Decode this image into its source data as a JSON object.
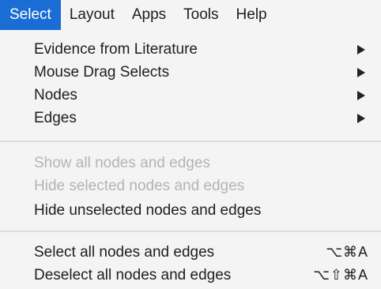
{
  "menubar": {
    "items": [
      {
        "label": "Select"
      },
      {
        "label": "Layout"
      },
      {
        "label": "Apps"
      },
      {
        "label": "Tools"
      },
      {
        "label": "Help"
      }
    ]
  },
  "menu": {
    "items": [
      {
        "label": "Evidence from Literature",
        "submenu": true
      },
      {
        "label": "Mouse Drag Selects",
        "submenu": true
      },
      {
        "label": "Nodes",
        "submenu": true
      },
      {
        "label": "Edges",
        "submenu": true
      },
      {
        "label": "Show all nodes and edges",
        "enabled": false
      },
      {
        "label": "Hide selected nodes and edges",
        "enabled": false
      },
      {
        "label": "Hide unselected nodes and edges",
        "enabled": true
      },
      {
        "label": "Select all nodes and edges",
        "shortcut": "⌥⌘A"
      },
      {
        "label": "Deselect all nodes and edges",
        "shortcut": "⌥⇧⌘A"
      }
    ]
  },
  "colors": {
    "menu_background": "#f4f4f4",
    "active_highlight": "#1b6dd6",
    "disabled_text": "#b4b4b4"
  }
}
